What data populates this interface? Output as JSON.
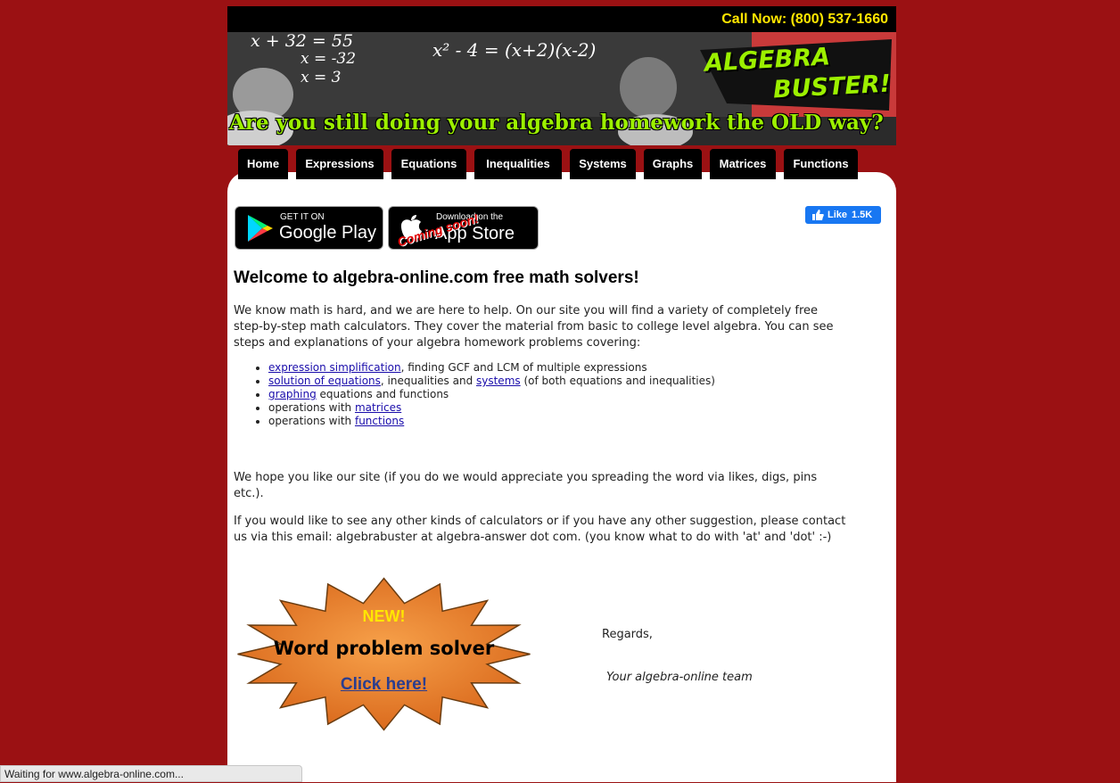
{
  "header": {
    "call_now": "Call Now: (800) 537-1660",
    "banner_equation_1": "x + 32 = 55",
    "banner_equation_2": "x = -32",
    "banner_equation_3": "x = 3",
    "banner_equation_4": "x² - 4 = (x+2)(x-2)",
    "logo_line_1": "ALGEBRA",
    "logo_line_2": "BUSTER!",
    "tagline": "Are you still doing your algebra homework the OLD way?"
  },
  "nav": {
    "items": [
      "Home",
      "Expressions",
      "Equations",
      "Inequalities",
      "Systems",
      "Graphs",
      "Matrices",
      "Functions"
    ]
  },
  "stores": {
    "google_small": "GET IT ON",
    "google_big": "Google Play",
    "apple_small": "Download on the",
    "apple_big": "App Store",
    "apple_overlay": "Coming soon!"
  },
  "facebook": {
    "like_label": "Like",
    "like_count": "1.5K"
  },
  "main": {
    "heading": "Welcome to algebra-online.com free math solvers!",
    "intro": "We know math is hard, and we are here to help. On our site you will find a variety of completely free step-by-step math calculators. They cover the material from basic to college level algebra. You can see steps and explanations of your algebra homework problems covering:",
    "list": {
      "item1_link": "expression simplification",
      "item1_text": ", finding GCF and LCM of multiple expressions",
      "item2_link1": "solution of equations",
      "item2_text1": ", inequalities and ",
      "item2_link2": "systems",
      "item2_text2": " (of both equations and inequalities)",
      "item3_link": "graphing",
      "item3_text": " equations and functions",
      "item4_text": "operations with ",
      "item4_link": "matrices",
      "item5_text": "operations with ",
      "item5_link": "functions"
    },
    "hope": "We hope you like our site (if you do we would appreciate you spreading the word via likes, digs, pins etc.).",
    "contact": "If you would like to see any other kinds of calculators or if you have any other suggestion, please contact us via this email: algebrabuster at algebra-answer dot com. (you know what to do with 'at' and 'dot' :-)",
    "regards": "Regards,",
    "team": "Your algebra-online team"
  },
  "promo": {
    "new_label": "NEW!",
    "title": "Word problem solver",
    "link": "Click here!"
  },
  "status": {
    "text": "Waiting for www.algebra-online.com..."
  },
  "colors": {
    "page_bg": "#9b1113",
    "call_yellow": "#ffe600",
    "tagline_green": "#9cf000",
    "burst_orange": "#e8781e"
  }
}
